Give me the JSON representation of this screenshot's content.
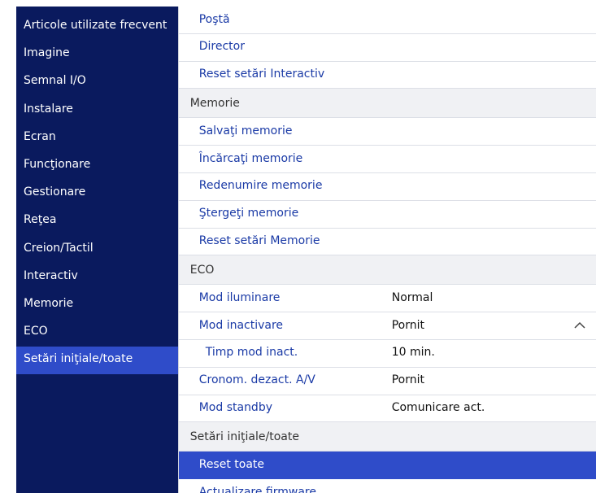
{
  "sidebar": {
    "items": [
      {
        "label": "Articole utilizate frecvent"
      },
      {
        "label": "Imagine"
      },
      {
        "label": "Semnal I/O"
      },
      {
        "label": "Instalare"
      },
      {
        "label": "Ecran"
      },
      {
        "label": "Funcţionare"
      },
      {
        "label": "Gestionare"
      },
      {
        "label": "Reţea"
      },
      {
        "label": "Creion/Tactil"
      },
      {
        "label": "Interactiv"
      },
      {
        "label": "Memorie"
      },
      {
        "label": "ECO"
      },
      {
        "label": "Setări iniţiale/toate"
      }
    ]
  },
  "main": {
    "top_items": [
      {
        "label": "Poştă"
      },
      {
        "label": "Director"
      },
      {
        "label": "Reset setări Interactiv"
      }
    ],
    "memorie": {
      "header": "Memorie",
      "items": [
        {
          "label": "Salvaţi memorie"
        },
        {
          "label": "Încărcaţi memorie"
        },
        {
          "label": "Redenumire memorie"
        },
        {
          "label": "Ştergeţi memorie"
        },
        {
          "label": "Reset setări Memorie"
        }
      ]
    },
    "eco": {
      "header": "ECO",
      "items": [
        {
          "label": "Mod iluminare",
          "value": "Normal"
        },
        {
          "label": "Mod inactivare",
          "value": "Pornit",
          "icon": "chevron-up-icon"
        },
        {
          "label": "Timp mod inact.",
          "value": "10 min."
        },
        {
          "label": "Cronom. dezact. A/V",
          "value": "Pornit"
        },
        {
          "label": "Mod standby",
          "value": "Comunicare act."
        }
      ]
    },
    "setari": {
      "header": "Setări iniţiale/toate",
      "items": [
        {
          "label": "Reset toate"
        },
        {
          "label": "Actualizare firmware"
        }
      ]
    }
  },
  "colors": {
    "sidebar_bg": "#0a1a5e",
    "selected_bg": "#2f4cc9",
    "item_text": "#1a3aa6"
  }
}
